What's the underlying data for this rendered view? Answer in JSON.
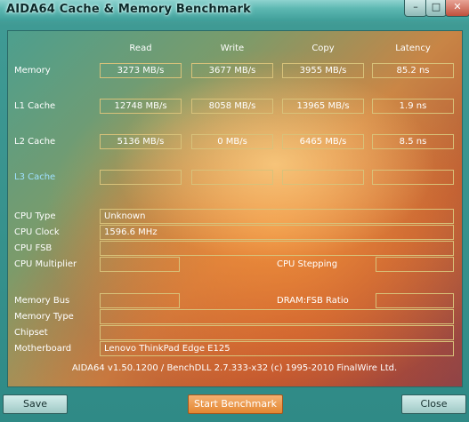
{
  "window": {
    "title": "AIDA64 Cache & Memory Benchmark",
    "controls": {
      "minimize": "–",
      "maximize": "□",
      "close": "✕"
    }
  },
  "columns": [
    "Read",
    "Write",
    "Copy",
    "Latency"
  ],
  "rows": [
    {
      "label": "Memory",
      "values": [
        "3273 MB/s",
        "3677 MB/s",
        "3955 MB/s",
        "85.2 ns"
      ]
    },
    {
      "label": "L1 Cache",
      "values": [
        "12748 MB/s",
        "8058 MB/s",
        "13965 MB/s",
        "1.9 ns"
      ]
    },
    {
      "label": "L2 Cache",
      "values": [
        "5136 MB/s",
        "0 MB/s",
        "6465 MB/s",
        "8.5 ns"
      ]
    },
    {
      "label": "L3 Cache",
      "values": [
        "",
        "",
        "",
        ""
      ]
    }
  ],
  "info": {
    "cpu_type": {
      "label": "CPU Type",
      "value": "Unknown"
    },
    "cpu_clock": {
      "label": "CPU Clock",
      "value": "1596.6 MHz"
    },
    "cpu_fsb": {
      "label": "CPU FSB",
      "value": ""
    },
    "cpu_multiplier": {
      "label": "CPU Multiplier",
      "value": ""
    },
    "cpu_stepping": {
      "label": "CPU Stepping",
      "value": ""
    },
    "memory_bus": {
      "label": "Memory Bus",
      "value": ""
    },
    "dram_fsb_ratio": {
      "label": "DRAM:FSB Ratio",
      "value": ""
    },
    "memory_type": {
      "label": "Memory Type",
      "value": ""
    },
    "chipset": {
      "label": "Chipset",
      "value": ""
    },
    "motherboard": {
      "label": "Motherboard",
      "value": "Lenovo ThinkPad Edge E125"
    }
  },
  "footer": "AIDA64 v1.50.1200 / BenchDLL 2.7.333-x32  (c) 1995-2010 FinalWire Ltd.",
  "buttons": {
    "save": "Save",
    "start": "Start Benchmark",
    "close": "Close"
  },
  "colors": {
    "accent_button": "#e48731",
    "label_l3": "#9fe0ff",
    "box_border": "#d8c27a"
  }
}
